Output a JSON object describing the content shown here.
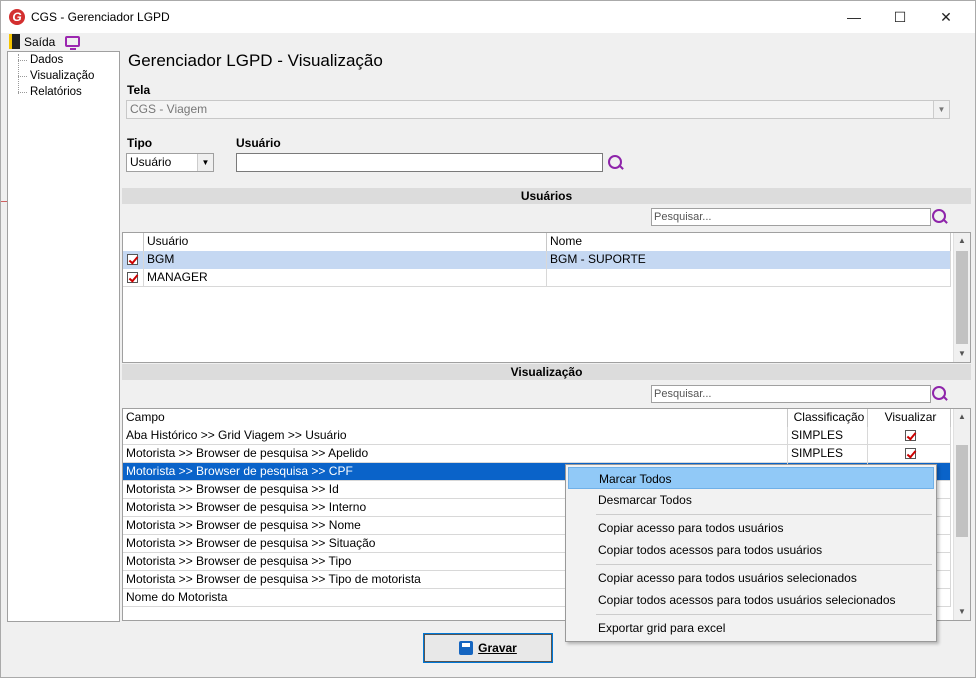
{
  "window": {
    "title": "CGS - Gerenciador LGPD",
    "minimize": "—",
    "maximize": "☐",
    "close": "✕"
  },
  "menu": {
    "exit_label": "Saída"
  },
  "tree": {
    "items": [
      "Dados",
      "Visualização",
      "Relatórios"
    ]
  },
  "page_title": "Gerenciador LGPD - Visualização",
  "tela": {
    "label": "Tela",
    "value": "CGS - Viagem"
  },
  "tipo": {
    "label": "Tipo",
    "value": "Usuário"
  },
  "usuario": {
    "label": "Usuário",
    "value": ""
  },
  "users_section": {
    "title": "Usuários",
    "search_placeholder": "Pesquisar...",
    "headers": [
      "Usuário",
      "Nome"
    ],
    "rows": [
      {
        "usuario": "BGM",
        "nome": "BGM - SUPORTE",
        "checked": true
      },
      {
        "usuario": "MANAGER",
        "nome": "",
        "checked": true
      }
    ]
  },
  "view_section": {
    "title": "Visualização",
    "search_placeholder": "Pesquisar...",
    "headers": [
      "Campo",
      "Classificação",
      "Visualizar"
    ],
    "rows": [
      {
        "campo": "Aba Histórico >> Grid Viagem >> Usuário",
        "classificacao": "SIMPLES",
        "visualizar": true
      },
      {
        "campo": "Motorista >> Browser de pesquisa >> Apelido",
        "classificacao": "SIMPLES",
        "visualizar": true
      },
      {
        "campo": "Motorista >> Browser de pesquisa >> CPF",
        "classificacao": "",
        "visualizar": null
      },
      {
        "campo": "Motorista >> Browser de pesquisa >> Id",
        "classificacao": "",
        "visualizar": null
      },
      {
        "campo": "Motorista >> Browser de pesquisa >> Interno",
        "classificacao": "",
        "visualizar": null
      },
      {
        "campo": "Motorista >> Browser de pesquisa >> Nome",
        "classificacao": "",
        "visualizar": null
      },
      {
        "campo": "Motorista >> Browser de pesquisa >> Situação",
        "classificacao": "",
        "visualizar": null
      },
      {
        "campo": "Motorista >> Browser de pesquisa >> Tipo",
        "classificacao": "",
        "visualizar": null
      },
      {
        "campo": "Motorista >> Browser de pesquisa >> Tipo de motorista",
        "classificacao": "",
        "visualizar": null
      },
      {
        "campo": "Nome do Motorista",
        "classificacao": "",
        "visualizar": null
      }
    ]
  },
  "context_menu": {
    "items": [
      "Marcar Todos",
      "Desmarcar Todos",
      "Copiar acesso para todos usuários",
      "Copiar todos acessos para todos usuários",
      "Copiar acesso para todos usuários selecionados",
      "Copiar todos acessos para todos usuários selecionados",
      "Exportar grid para excel"
    ]
  },
  "save_button": {
    "label": "Gravar"
  },
  "colors": {
    "selection": "#0a63c9",
    "light_selection": "#c5d8f2",
    "accent": "#8e24aa",
    "menu_highlight": "#91c9f7"
  }
}
